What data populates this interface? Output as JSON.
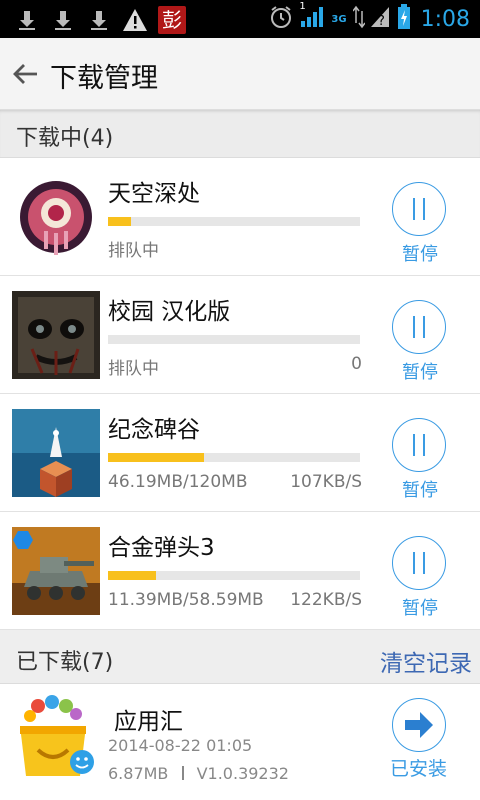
{
  "status_bar": {
    "time": "1:08",
    "network": "3G",
    "sim_index": "1",
    "badge_char": "彭"
  },
  "header": {
    "title": "下载管理"
  },
  "downloading": {
    "title": "下载中(4)",
    "pause_label": "暂停",
    "items": [
      {
        "name": "天空深处",
        "progress": 0.09,
        "left": "排队中",
        "right": ""
      },
      {
        "name": "校园 汉化版",
        "progress": 0,
        "left": "排队中",
        "right": "0"
      },
      {
        "name": "纪念碑谷",
        "progress": 0.38,
        "left": "46.19MB/120MB",
        "right": "107KB/S"
      },
      {
        "name": "合金弹头3",
        "progress": 0.19,
        "left": "11.39MB/58.59MB",
        "right": "122KB/S"
      }
    ]
  },
  "downloaded": {
    "title": "已下载(7)",
    "clear_label": "清空记录",
    "item": {
      "name": "应用汇",
      "date": "2014-08-22 01:05",
      "size": "6.87MB",
      "version": "V1.0.39232",
      "action": "已安装"
    }
  },
  "colors": {
    "accent": "#3a9be3",
    "progress": "#f8c01c",
    "link": "#3d68b3"
  }
}
